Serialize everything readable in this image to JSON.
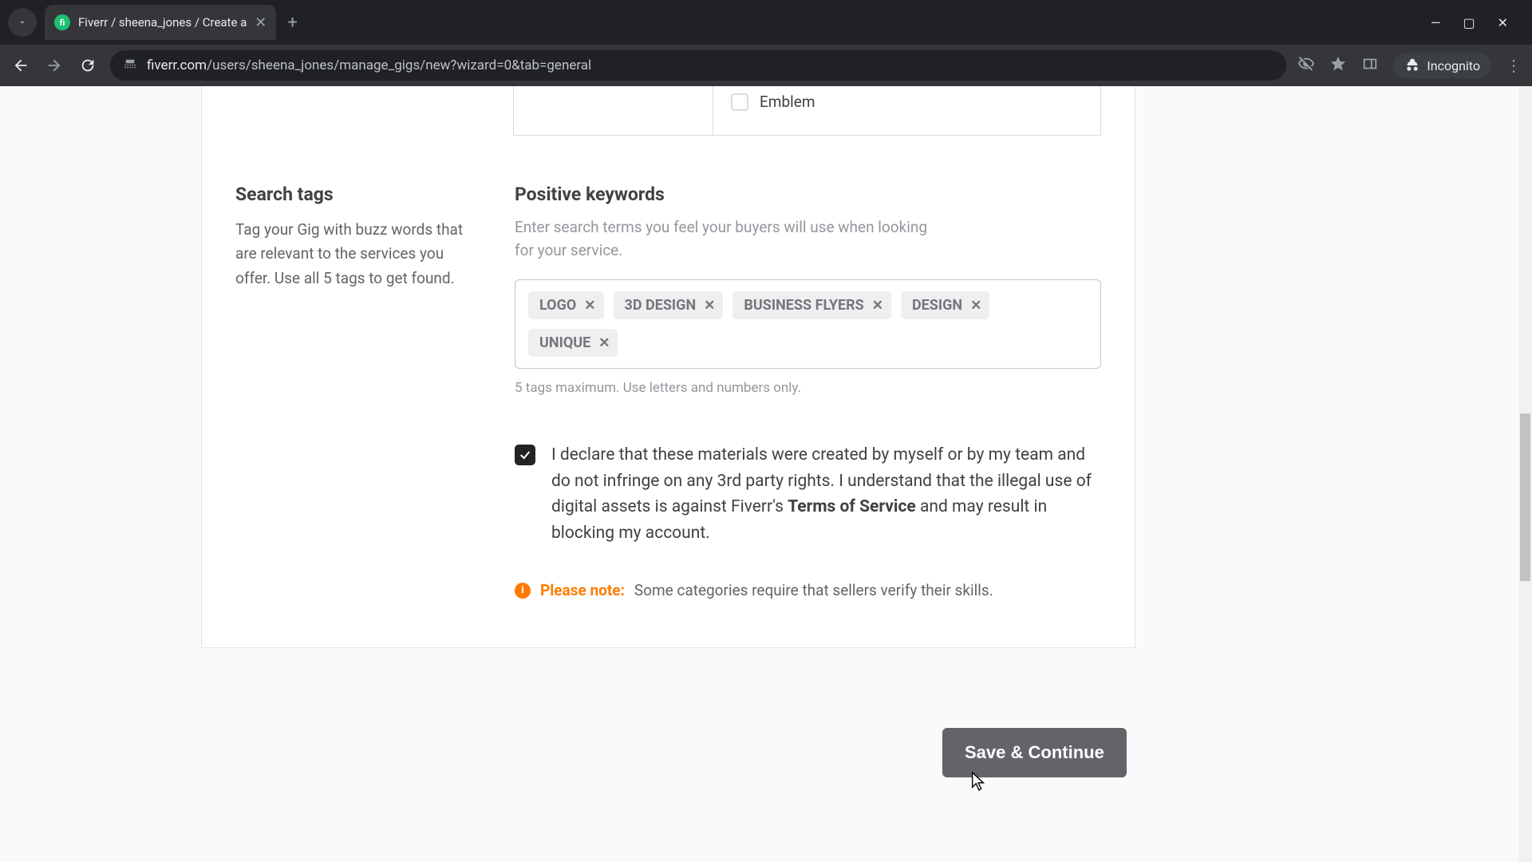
{
  "browser": {
    "tab_title": "Fiverr / sheena_jones / Create a",
    "url_display_domain": "fiverr.com",
    "url_display_path": "/users/sheena_jones/manage_gigs/new?wizard=0&tab=general",
    "incognito_label": "Incognito"
  },
  "emblem": {
    "label": "Emblem"
  },
  "search_tags": {
    "title": "Search tags",
    "description": "Tag your Gig with buzz words that are relevant to the services you offer. Use all 5 tags to get found."
  },
  "positive_keywords": {
    "title": "Positive keywords",
    "description": "Enter search terms you feel your buyers will use when looking for your service.",
    "tags": [
      "LOGO",
      "3D DESIGN",
      "BUSINESS FLYERS",
      "DESIGN",
      "UNIQUE"
    ],
    "hint": "5 tags maximum. Use letters and numbers only."
  },
  "declaration": {
    "checked": true,
    "text_before": "I declare that these materials were created by myself or by my team and do not infringe on any 3rd party rights. I understand that the illegal use of digital assets is against Fiverr's ",
    "tos_label": "Terms of Service",
    "text_after": " and may result in blocking my account."
  },
  "note": {
    "label": "Please note:",
    "text": "Some categories require that sellers verify their skills."
  },
  "actions": {
    "save_continue": "Save & Continue"
  }
}
